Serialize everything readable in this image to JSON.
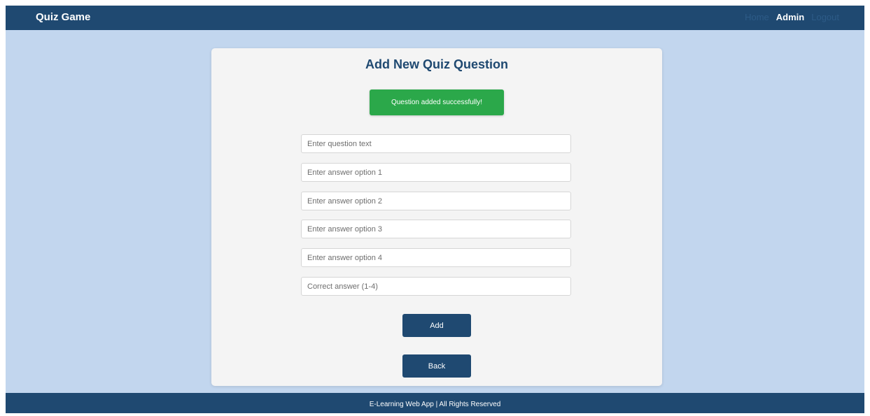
{
  "navbar": {
    "brand": "Quiz Game",
    "links": [
      {
        "label": "Home",
        "active": false
      },
      {
        "label": "Admin",
        "active": true
      },
      {
        "label": "Logout",
        "active": false
      }
    ]
  },
  "card": {
    "title": "Add New Quiz Question",
    "alert": "Question added successfully!",
    "fields": {
      "question": {
        "placeholder": "Enter question text",
        "value": ""
      },
      "option1": {
        "placeholder": "Enter answer option 1",
        "value": ""
      },
      "option2": {
        "placeholder": "Enter answer option 2",
        "value": ""
      },
      "option3": {
        "placeholder": "Enter answer option 3",
        "value": ""
      },
      "option4": {
        "placeholder": "Enter answer option 4",
        "value": ""
      },
      "correct": {
        "placeholder": "Correct answer (1-4)",
        "value": ""
      }
    },
    "add_label": "Add",
    "back_label": "Back"
  },
  "footer": {
    "text": "E-Learning Web App | All Rights Reserved"
  },
  "colors": {
    "primary": "#1f4971",
    "page_background": "#c2d6ee",
    "card_background": "#f4f4f4",
    "success": "#2ba84a",
    "nav_inactive": "#2d5b87"
  }
}
